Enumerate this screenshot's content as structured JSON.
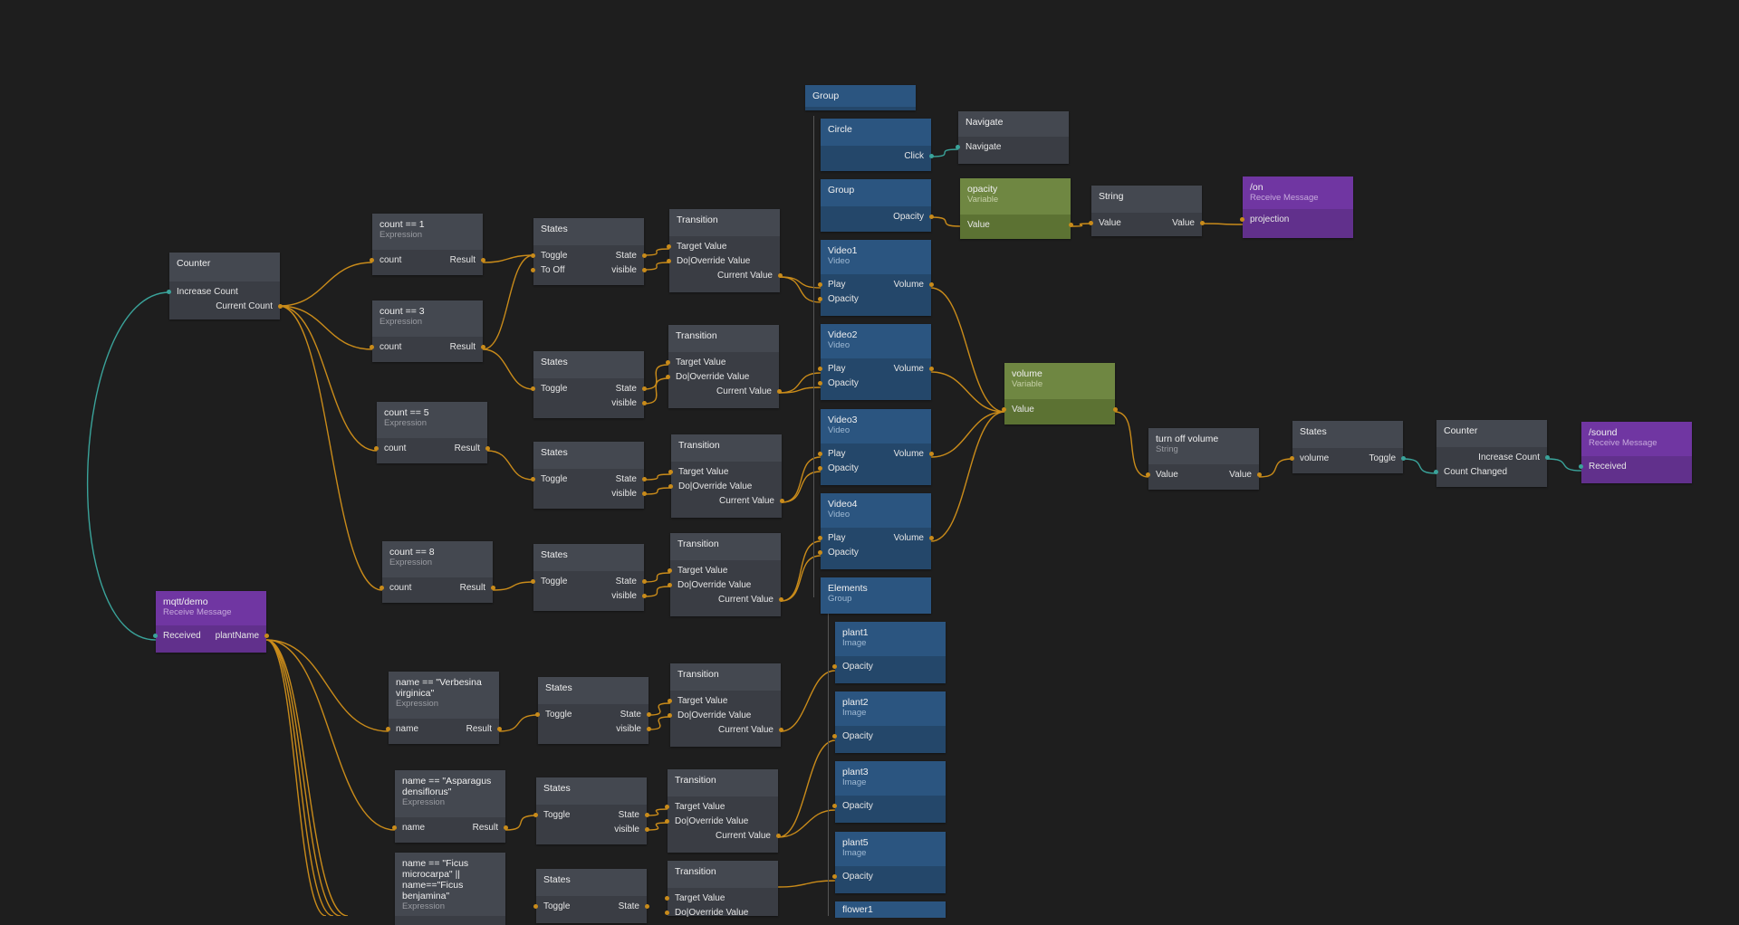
{
  "colors": {
    "background": "#1e1e1e",
    "wire_signal": "#c98b1a",
    "wire_event": "#3aa39a",
    "visual_node": "#2b5580",
    "variable_node": "#6f8742",
    "receive_node": "#7036a2",
    "logic_node": "#3a3d44"
  },
  "nodes": {
    "group_top": {
      "title": "Group"
    },
    "circle": {
      "title": "Circle",
      "out1": "Click"
    },
    "navigate": {
      "title": "Navigate",
      "in1": "Navigate"
    },
    "group_opacity": {
      "title": "Group",
      "out1": "Opacity"
    },
    "opacity_var": {
      "title": "opacity",
      "sub": "Variable",
      "in1": "Value"
    },
    "string1": {
      "title": "String",
      "in1": "Value",
      "out1": "Value"
    },
    "on_msg": {
      "title": "/on",
      "sub": "Receive Message",
      "out1": "projection"
    },
    "video1": {
      "title": "Video1",
      "sub": "Video",
      "in1": "Play",
      "in2": "Opacity",
      "out1": "Volume"
    },
    "video2": {
      "title": "Video2",
      "sub": "Video",
      "in1": "Play",
      "in2": "Opacity",
      "out1": "Volume"
    },
    "video3": {
      "title": "Video3",
      "sub": "Video",
      "in1": "Play",
      "in2": "Opacity",
      "out1": "Volume"
    },
    "video4": {
      "title": "Video4",
      "sub": "Video",
      "in1": "Play",
      "in2": "Opacity",
      "out1": "Volume"
    },
    "elements": {
      "title": "Elements",
      "sub": "Group"
    },
    "volume_var": {
      "title": "volume",
      "sub": "Variable",
      "in1": "Value"
    },
    "turnoff": {
      "title": "turn off volume",
      "sub": "String",
      "in1": "Value",
      "out1": "Value"
    },
    "states_vol": {
      "title": "States",
      "in1": "volume",
      "out1": "Toggle"
    },
    "counter2": {
      "title": "Counter",
      "in1": "Increase Count",
      "out1": "Count Changed"
    },
    "sound_msg": {
      "title": "/sound",
      "sub": "Receive Message",
      "out1": "Received"
    },
    "counter1": {
      "title": "Counter",
      "in1": "Increase Count",
      "out1": "Current Count"
    },
    "expr1": {
      "title": "count == 1",
      "sub": "Expression",
      "in1": "count",
      "out1": "Result"
    },
    "expr3": {
      "title": "count == 3",
      "sub": "Expression",
      "in1": "count",
      "out1": "Result"
    },
    "expr5": {
      "title": "count == 5",
      "sub": "Expression",
      "in1": "count",
      "out1": "Result"
    },
    "expr8": {
      "title": "count == 8",
      "sub": "Expression",
      "in1": "count",
      "out1": "Result"
    },
    "states1": {
      "title": "States",
      "in1": "Toggle",
      "in2": "To Off",
      "out1": "State",
      "out2": "visible"
    },
    "states2": {
      "title": "States",
      "in1": "Toggle",
      "out1": "State",
      "out2": "visible"
    },
    "states3": {
      "title": "States",
      "in1": "Toggle",
      "out1": "State",
      "out2": "visible"
    },
    "states4": {
      "title": "States",
      "in1": "Toggle",
      "out1": "State",
      "out2": "visible"
    },
    "trans1": {
      "title": "Transition",
      "in1": "Target Value",
      "in2": "Do|Override Value",
      "out1": "Current Value"
    },
    "trans2": {
      "title": "Transition",
      "in1": "Target Value",
      "in2": "Do|Override Value",
      "out1": "Current Value"
    },
    "trans3": {
      "title": "Transition",
      "in1": "Target Value",
      "in2": "Do|Override Value",
      "out1": "Current Value"
    },
    "trans4": {
      "title": "Transition",
      "in1": "Target Value",
      "in2": "Do|Override Value",
      "out1": "Current Value"
    },
    "mqtt": {
      "title": "mqtt/demo",
      "sub": "Receive Message",
      "in1": "Received",
      "out1": "plantName"
    },
    "exprV": {
      "title": "name == \"Verbesina virginica\"",
      "sub": "Expression",
      "in1": "name",
      "out1": "Result"
    },
    "exprA": {
      "title": "name == \"Asparagus densiflorus\"",
      "sub": "Expression",
      "in1": "name",
      "out1": "Result"
    },
    "exprF": {
      "title": "name == \"Ficus microcarpa\" || name==\"Ficus benjamina\"",
      "sub": "Expression"
    },
    "states5": {
      "title": "States",
      "in1": "Toggle",
      "out1": "State",
      "out2": "visible"
    },
    "states6": {
      "title": "States",
      "in1": "Toggle",
      "out1": "State",
      "out2": "visible"
    },
    "states7": {
      "title": "States",
      "in1": "Toggle",
      "out1": "State"
    },
    "trans5": {
      "title": "Transition",
      "in1": "Target Value",
      "in2": "Do|Override Value",
      "out1": "Current Value"
    },
    "trans6": {
      "title": "Transition",
      "in1": "Target Value",
      "in2": "Do|Override Value",
      "out1": "Current Value"
    },
    "trans7": {
      "title": "Transition",
      "in1": "Target Value",
      "in2": "Do|Override Value"
    },
    "plant1": {
      "title": "plant1",
      "sub": "Image",
      "in1": "Opacity"
    },
    "plant2": {
      "title": "plant2",
      "sub": "Image",
      "in1": "Opacity"
    },
    "plant3": {
      "title": "plant3",
      "sub": "Image",
      "in1": "Opacity"
    },
    "plant5": {
      "title": "plant5",
      "sub": "Image",
      "in1": "Opacity"
    },
    "flower1": {
      "title": "flower1"
    }
  }
}
